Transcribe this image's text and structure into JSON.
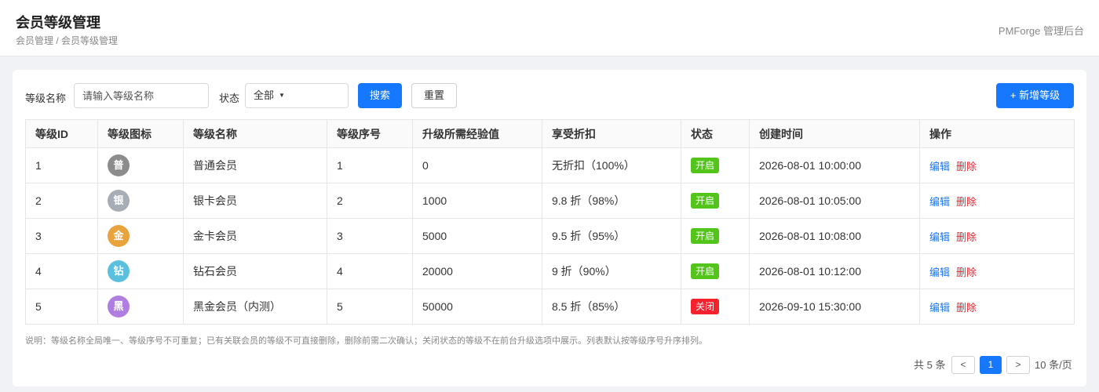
{
  "header": {
    "title": "会员等级管理",
    "breadcrumb": "会员管理 / 会员等级管理",
    "brand": "PMForge 管理后台"
  },
  "filters": {
    "name_label": "等级名称",
    "name_placeholder": "请输入等级名称",
    "status_label": "状态",
    "status_value": "全部",
    "search_label": "搜索",
    "reset_label": "重置",
    "add_label": "+ 新增等级"
  },
  "table": {
    "columns": [
      "等级ID",
      "等级图标",
      "等级名称",
      "等级序号",
      "升级所需经验值",
      "享受折扣",
      "状态",
      "创建时间",
      "操作"
    ],
    "rows": [
      {
        "id": "1",
        "icon": "普",
        "icon_color": "#8c8c8c",
        "name": "普通会员",
        "order": "1",
        "exp": "0",
        "discount": "无折扣（100%）",
        "status": "开启",
        "status_color": "#52c41a",
        "created": "2026-08-01 10:00:00",
        "edit": "编辑",
        "delete": "删除"
      },
      {
        "id": "2",
        "icon": "银",
        "icon_color": "#a6adb4",
        "name": "银卡会员",
        "order": "2",
        "exp": "1000",
        "discount": "9.8 折（98%）",
        "status": "开启",
        "status_color": "#52c41a",
        "created": "2026-08-01 10:05:00",
        "edit": "编辑",
        "delete": "删除"
      },
      {
        "id": "3",
        "icon": "金",
        "icon_color": "#e8a33d",
        "name": "金卡会员",
        "order": "3",
        "exp": "5000",
        "discount": "9.5 折（95%）",
        "status": "开启",
        "status_color": "#52c41a",
        "created": "2026-08-01 10:08:00",
        "edit": "编辑",
        "delete": "删除"
      },
      {
        "id": "4",
        "icon": "钻",
        "icon_color": "#5bc0de",
        "name": "钻石会员",
        "order": "4",
        "exp": "20000",
        "discount": "9 折（90%）",
        "status": "开启",
        "status_color": "#52c41a",
        "created": "2026-08-01 10:12:00",
        "edit": "编辑",
        "delete": "删除"
      },
      {
        "id": "5",
        "icon": "黑",
        "icon_color": "#b07ee0",
        "name": "黑金会员（内测）",
        "order": "5",
        "exp": "50000",
        "discount": "8.5 折（85%）",
        "status": "关闭",
        "status_color": "#f5222d",
        "created": "2026-09-10 15:30:00",
        "edit": "编辑",
        "delete": "删除"
      }
    ]
  },
  "note": "说明：等级名称全局唯一、等级序号不可重复；已有关联会员的等级不可直接删除，删除前需二次确认；关闭状态的等级不在前台升级选项中展示。列表默认按等级序号升序排列。",
  "pagination": {
    "total": "共 5 条",
    "prev": "<",
    "current": "1",
    "next": ">",
    "page_size": "10 条/页"
  }
}
